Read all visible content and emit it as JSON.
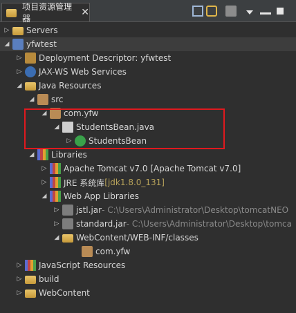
{
  "tab": {
    "title": "项目资源管理器",
    "close": "✕"
  },
  "toolbar": {
    "icons": [
      "collapse-all-icon",
      "link-editor-icon",
      "filter-icon",
      "view-menu-icon",
      "minimize-icon",
      "maximize-icon"
    ]
  },
  "tree": [
    {
      "label": "Servers",
      "decor": "",
      "arrow": "▷",
      "icon": "folder"
    },
    {
      "label": "yfwtest",
      "decor": "",
      "arrow": "◢",
      "icon": "project"
    },
    {
      "label": "Deployment Descriptor: yfwtest",
      "decor": "",
      "arrow": "▷",
      "icon": "dd"
    },
    {
      "label": "JAX-WS Web Services",
      "decor": "",
      "arrow": "▷",
      "icon": "web"
    },
    {
      "label": "Java Resources",
      "decor": "",
      "arrow": "◢",
      "icon": "folder"
    },
    {
      "label": "src",
      "decor": "",
      "arrow": "◢",
      "icon": "pkg"
    },
    {
      "label": "com.yfw",
      "decor": "",
      "arrow": "◢",
      "icon": "pkg"
    },
    {
      "label": "StudentsBean.java",
      "decor": "",
      "arrow": "◢",
      "icon": "java"
    },
    {
      "label": "StudentsBean",
      "decor": "",
      "arrow": "▷",
      "icon": "class"
    },
    {
      "label": "Libraries",
      "decor": "",
      "arrow": "◢",
      "icon": "lib"
    },
    {
      "label": "Apache Tomcat v7.0 [Apache Tomcat v7.0]",
      "decor": "",
      "arrow": "▷",
      "icon": "lib"
    },
    {
      "label": "JRE 系统库",
      "decor": " [jdk1.8.0_131]",
      "arrow": "▷",
      "icon": "lib"
    },
    {
      "label": "Web App Libraries",
      "decor": "",
      "arrow": "◢",
      "icon": "lib"
    },
    {
      "label": "jstl.jar",
      "decor": " - C:\\Users\\Administrator\\Desktop\\tomcatNEO",
      "arrow": "▷",
      "icon": "jar"
    },
    {
      "label": "standard.jar",
      "decor": " - C:\\Users\\Administrator\\Desktop\\tomca",
      "arrow": "▷",
      "icon": "jar"
    },
    {
      "label": "WebContent/WEB-INF/classes",
      "decor": "",
      "arrow": "◢",
      "icon": "folder"
    },
    {
      "label": "com.yfw",
      "decor": "",
      "arrow": "",
      "icon": "pkg"
    },
    {
      "label": "JavaScript Resources",
      "decor": "",
      "arrow": "▷",
      "icon": "lib"
    },
    {
      "label": "build",
      "decor": "",
      "arrow": "▷",
      "icon": "folder"
    },
    {
      "label": "WebContent",
      "decor": "",
      "arrow": "▷",
      "icon": "folder"
    }
  ]
}
